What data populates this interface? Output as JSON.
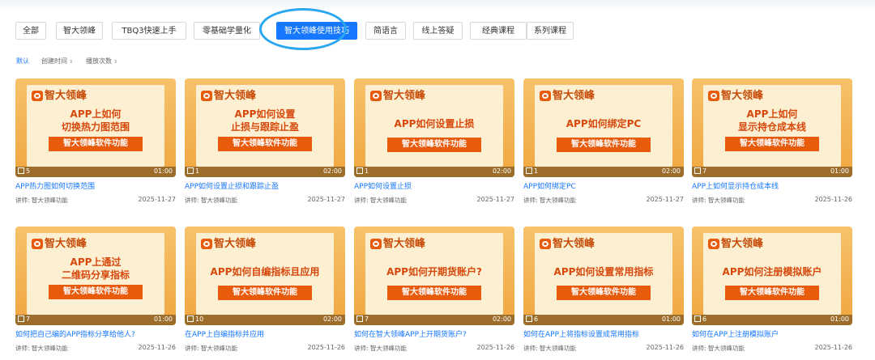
{
  "tabs": [
    "全部",
    "智大领峰",
    "TBQ3快速上手",
    "零基础学量化",
    "智大领峰使用技巧",
    "简语言",
    "线上答疑",
    "经典课程",
    "系列课程"
  ],
  "active_tab": "智大领峰使用技巧",
  "sort": {
    "default": "默认",
    "created": "创建时间",
    "plays": "播放次数",
    "arrow": "⇕"
  },
  "thumb_brand": "智大领峰",
  "thumb_banner": "智大领峰软件功能",
  "lecturer_prefix": "讲师:",
  "cards": [
    {
      "thumb_lines": [
        "APP上如何",
        "切换热力图范围"
      ],
      "count": "5",
      "duration": "01:00",
      "title": "APP热力图如何切换范围",
      "lecturer": "智大领峰功能",
      "date": "2025-11-27"
    },
    {
      "thumb_lines": [
        "APP如何设置",
        "止损与跟踪止盈"
      ],
      "count": "1",
      "duration": "02:00",
      "title": "APP如何设置止损和跟踪止盈",
      "lecturer": "智大领峰功能",
      "date": "2025-11-27"
    },
    {
      "thumb_lines": [
        "APP如何设置止损"
      ],
      "count": "1",
      "duration": "02:00",
      "title": "APP如何设置止损",
      "lecturer": "智大领峰功能",
      "date": "2025-11-27"
    },
    {
      "thumb_lines": [
        "APP如何绑定PC"
      ],
      "count": "1",
      "duration": "02:00",
      "title": "APP如何绑定PC",
      "lecturer": "智大领峰功能",
      "date": "2025-11-27"
    },
    {
      "thumb_lines": [
        "APP上如何",
        "显示持仓成本线"
      ],
      "count": "7",
      "duration": "01:00",
      "title": "APP上如何显示持仓成本线",
      "lecturer": "智大领峰功能",
      "date": "2025-11-26"
    },
    {
      "thumb_lines": [
        "APP上通过",
        "二维码分享指标"
      ],
      "count": "7",
      "duration": "01:00",
      "title": "如何把自己编的APP指标分享给他人?",
      "lecturer": "智大领峰功能",
      "date": "2025-11-26"
    },
    {
      "thumb_lines": [
        "APP如何自编指标且应用"
      ],
      "count": "10",
      "duration": "02:00",
      "title": "在APP上自编指标并应用",
      "lecturer": "智大领峰功能",
      "date": "2025-11-26"
    },
    {
      "thumb_lines": [
        "APP如何开期货账户?"
      ],
      "count": "7",
      "duration": "02:00",
      "title": "如何在智大领峰APP上开期货账户?",
      "lecturer": "智大领峰功能",
      "date": "2025-11-26"
    },
    {
      "thumb_lines": [
        "APP如何设置常用指标"
      ],
      "count": "6",
      "duration": "01:00",
      "title": "如何在APP上将指标设置成常用指标",
      "lecturer": "智大领峰功能",
      "date": "2025-11-26"
    },
    {
      "thumb_lines": [
        "APP如何注册模拟账户"
      ],
      "count": "6",
      "duration": "01:00",
      "title": "如何在APP上注册模拟账户",
      "lecturer": "智大领峰功能",
      "date": "2025-11-26"
    }
  ]
}
